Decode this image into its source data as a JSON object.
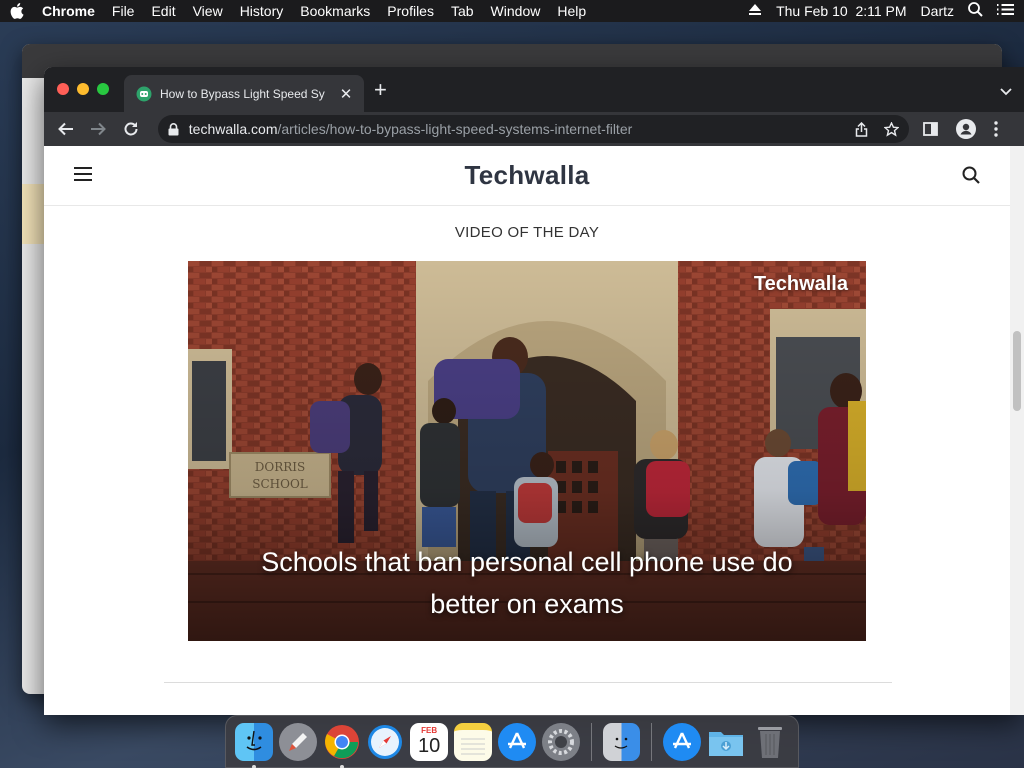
{
  "menubar": {
    "app_name": "Chrome",
    "items": [
      "File",
      "Edit",
      "View",
      "History",
      "Bookmarks",
      "Profiles",
      "Tab",
      "Window",
      "Help"
    ],
    "datetime": "Thu Feb 10  2:11 PM",
    "user": "Dartz"
  },
  "browser": {
    "tab_title": "How to Bypass Light Speed Sy",
    "url_host": "techwalla.com",
    "url_path": "/articles/how-to-bypass-light-speed-systems-internet-filter"
  },
  "page": {
    "logo": "Techwalla",
    "section_label": "VIDEO OF THE DAY",
    "video_watermark": "Techwalla",
    "video_caption": "Schools that ban personal cell phone use do better on exams",
    "video_sign": "DORRIS\nSCHOOL"
  },
  "dock": {
    "calendar_month": "FEB",
    "calendar_day": "10",
    "apps": [
      "finder-icon",
      "launchpad-icon",
      "chrome-icon",
      "safari-icon",
      "calendar-icon",
      "notes-icon",
      "app-store-icon",
      "system-preferences-icon",
      "migration-assistant-icon",
      "app-store-downloads-icon",
      "downloads-folder-icon",
      "trash-icon"
    ]
  },
  "colors": {
    "chrome_dark": "#202124",
    "chrome_toolbar": "#35363a",
    "logo": "#2f3542",
    "brick": "#8a3b2b"
  }
}
